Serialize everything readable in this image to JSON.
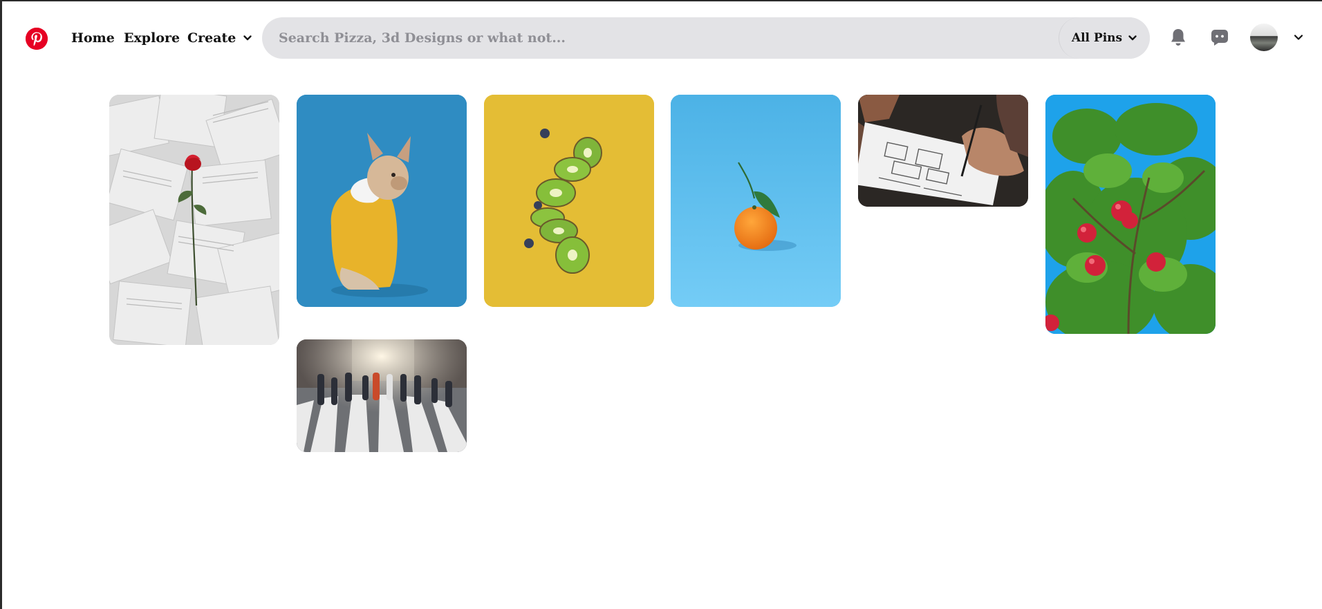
{
  "nav": {
    "logo_icon": "pinterest-logo-icon",
    "home": "Home",
    "explore": "Explore",
    "create": "Create"
  },
  "search": {
    "placeholder": "Search Pizza, 3d Designs or what not...",
    "value": "",
    "scope": "All Pins"
  },
  "header_icons": {
    "notifications": "bell-icon",
    "messages": "chat-icon",
    "profile": "avatar",
    "profile_menu": "chevron-down-icon"
  },
  "pins": [
    {
      "subject": "red-rose-on-book-pages"
    },
    {
      "subject": "french-bulldog-in-yellow-hoodie"
    },
    {
      "subject": "sliced-kiwi-and-blueberries"
    },
    {
      "subject": "tangerine-on-blue"
    },
    {
      "subject": "hand-sketching-wireframes"
    },
    {
      "subject": "apple-tree-against-sky"
    },
    {
      "subject": "crowd-crossing-street"
    }
  ],
  "colors": {
    "brand": "#e60023",
    "search_bg": "#e3e3e6",
    "placeholder": "#8f8f95",
    "icon_gray": "#6f6f75"
  }
}
